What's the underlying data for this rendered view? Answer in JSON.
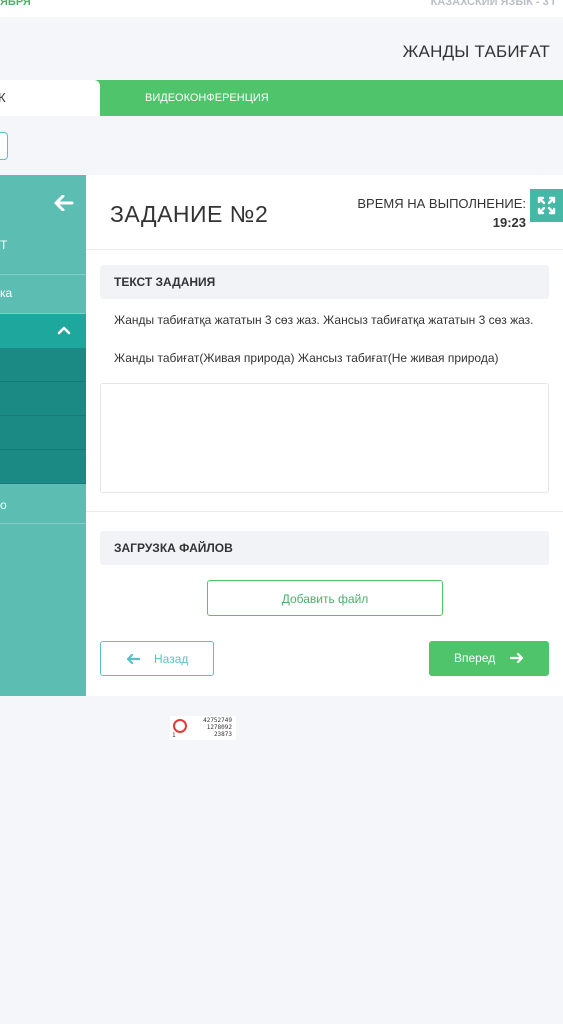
{
  "header": {
    "date_fragment": "ЯБРЯ",
    "subject": "КАЗАХСКИЙ ЯЗЫК - 3 Г",
    "lesson_title": "ЖАНДЫ ТАБИҒАТ"
  },
  "tabs": [
    {
      "label": "К",
      "active": true
    },
    {
      "label": "ВИДЕОКОНФЕРЕНЦИЯ",
      "active": false
    }
  ],
  "sidebar": {
    "items": [
      {
        "label": "Т"
      },
      {
        "label": "ка"
      },
      {
        "label": "о"
      }
    ]
  },
  "task": {
    "title": "ЗАДАНИЕ №2",
    "time_label": "ВРЕМЯ НА ВЫПОЛНЕНИЕ:",
    "time_value": "19:23",
    "text_section_title": "ТЕКСТ ЗАДАНИЯ",
    "text_line1": "Жанды табиғатқа жататын 3 сөз жаз. Жансыз табиғатқа жататын 3 сөз жаз.",
    "text_line2": "Жанды табиғат(Живая природа) Жансыз табиғат(Не живая природа)",
    "upload_section_title": "ЗАГРУЗКА ФАЙЛОВ",
    "add_file_label": "Добавить файл",
    "back_label": "Назад",
    "next_label": "Вперед"
  },
  "stamp": {
    "digit": "1",
    "numbers": [
      "42752749",
      "1278092",
      "23873"
    ]
  },
  "colors": {
    "accent_green": "#4fc46a",
    "sidebar_teal": "#5cbdb2",
    "sidebar_active": "#1ea79c",
    "sidebar_sub": "#1b8a84",
    "outline_teal": "#5bbfc7"
  },
  "icons": {
    "back": "arrow-left-icon",
    "collapse": "chevron-up-icon",
    "expand": "expand-icon",
    "prev": "arrow-left-icon",
    "next": "arrow-right-icon"
  }
}
